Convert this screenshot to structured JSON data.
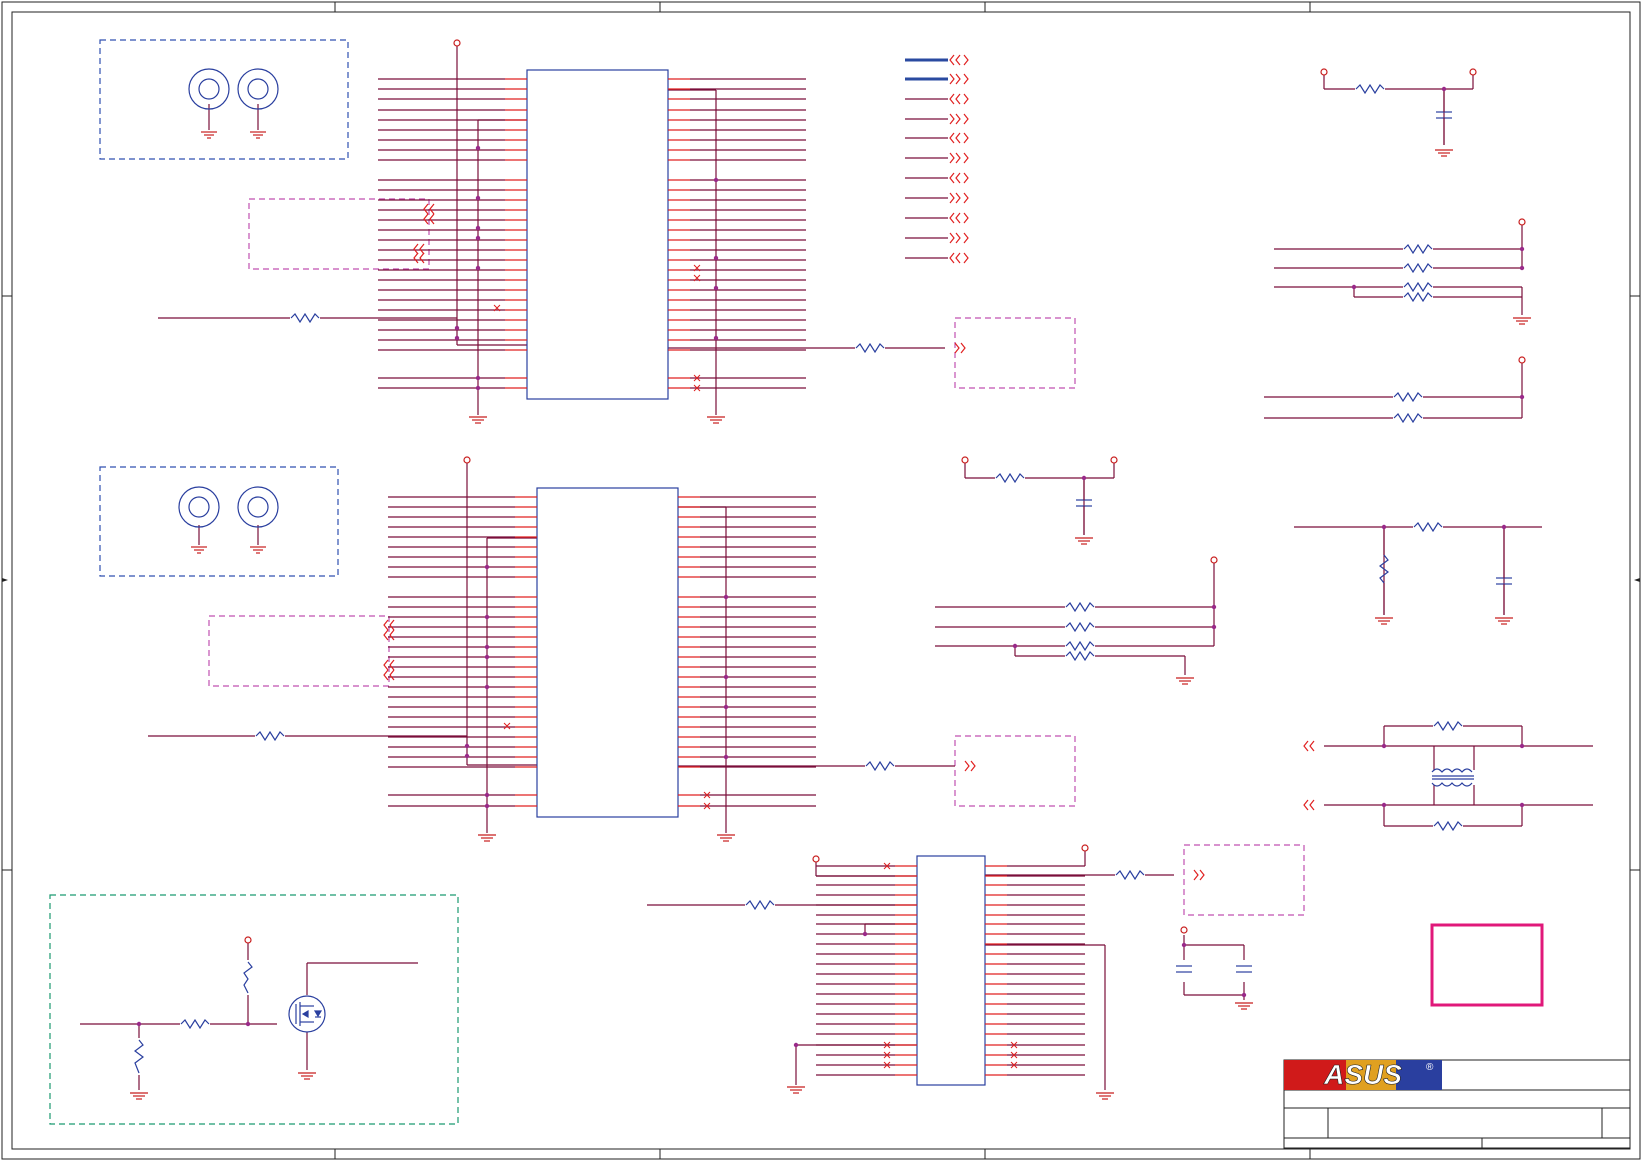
{
  "schematic": {
    "brand": "ASUS",
    "registered_mark": "®"
  },
  "colors": {
    "wire": "#7a0f3a",
    "pin": "#e02020",
    "net_power": "#c81e1e",
    "component": "#2a3f9f",
    "bus": "#2a4aa0",
    "group_blue": "#3050b0",
    "group_magenta": "#c050b0",
    "group_green": "#1a9a70",
    "note_box": "#e0187a",
    "logo_red": "#d01a1a",
    "logo_blue": "#2a3f9f",
    "frame": "#222222"
  }
}
